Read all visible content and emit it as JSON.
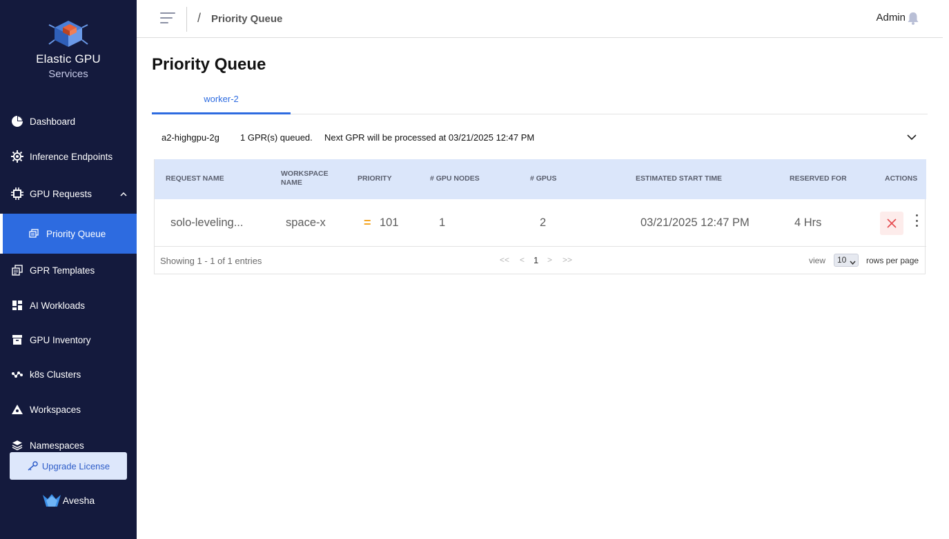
{
  "sidebar": {
    "logo_title": "Elastic GPU",
    "logo_sub": "Services",
    "items": [
      {
        "label": "Dashboard",
        "icon": "pie-chart-icon"
      },
      {
        "label": "Inference Endpoints",
        "icon": "gear-chip-icon"
      },
      {
        "label": "GPU Requests",
        "icon": "chip-icon"
      },
      {
        "label": "Priority Queue",
        "icon": "stacked-pages-icon",
        "active": true
      },
      {
        "label": "GPR Templates",
        "icon": "template-icon"
      },
      {
        "label": "AI Workloads",
        "icon": "grid-icon"
      },
      {
        "label": "GPU Inventory",
        "icon": "archive-box-icon"
      },
      {
        "label": "k8s Clusters",
        "icon": "cluster-nodes-icon"
      },
      {
        "label": "Workspaces",
        "icon": "workspace-icon"
      },
      {
        "label": "Namespaces",
        "icon": "layers-icon"
      }
    ],
    "upgrade_label": "Upgrade License",
    "brand": "Avesha"
  },
  "topbar": {
    "breadcrumb_sep": "/",
    "breadcrumb": "Priority Queue",
    "user": "Admin"
  },
  "main": {
    "title": "Priority Queue",
    "tabs": [
      {
        "label": "worker-2"
      }
    ],
    "queue": {
      "instance": "a2-highgpu-2g",
      "queued": "1 GPR(s) queued.",
      "next": "Next GPR will be processed at 03/21/2025 12:47 PM"
    },
    "table": {
      "headers": {
        "request_name": "REQUEST NAME",
        "workspace_l1": "WORKSPACE",
        "workspace_l2": "NAME",
        "priority": "PRIORITY",
        "gpu_nodes": "# GPU NODES",
        "gpus": "# GPUS",
        "est_start": "ESTIMATED START TIME",
        "reserved": "RESERVED FOR",
        "actions": "ACTIONS"
      },
      "rows": [
        {
          "request_name": "solo-leveling...",
          "workspace": "space-x",
          "priority_icon": "=",
          "priority": "101",
          "gpu_nodes": "1",
          "gpus": "2",
          "est_start": "03/21/2025 12:47 PM",
          "reserved": "4 Hrs"
        }
      ],
      "footer": {
        "showing": "Showing 1 - 1 of 1 entries",
        "first": "<<",
        "prev": "<",
        "page": "1",
        "next": ">",
        "last": ">>",
        "view_label": "view",
        "rows_value": "10",
        "rows_label": "rows per page"
      }
    }
  },
  "colors": {
    "sidebar_bg": "#141a3d",
    "accent": "#2d6be0",
    "header_bg": "#dbe6fa",
    "priority_equal": "#f5a623",
    "cancel": "#e5484d"
  }
}
